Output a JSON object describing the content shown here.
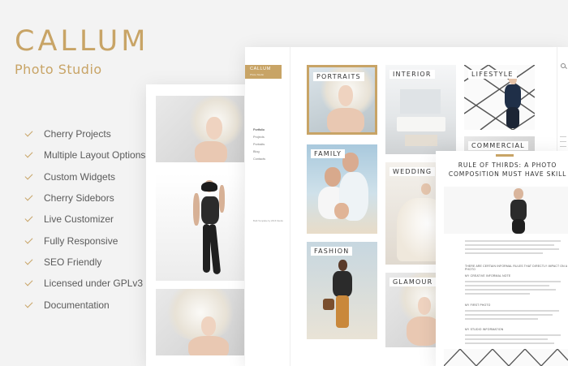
{
  "brand": {
    "title": "CALLUM",
    "subtitle": "Photo Studio"
  },
  "features": [
    "Cherry Projects",
    "Multiple Layout Options",
    "Custom Widgets",
    "Cherry Sidebors",
    "Live Customizer",
    "Fully Responsive",
    "SEO Friendly",
    "Licensed under GPLv3",
    "Documentation"
  ],
  "preview": {
    "logo": {
      "name": "CALLUM",
      "tagline": "Photo Studio"
    },
    "nav": [
      "Portfolio",
      "Projects",
      "Portraits",
      "Blog",
      "Contacts"
    ],
    "footer_text": "Built Template by 2016 Studio",
    "tiles": [
      "PORTRAITS",
      "INTERIOR",
      "LIFESTYLE",
      "FAMILY",
      "WEDDING",
      "COMMERCIAL",
      "FASHION",
      "GLAMOUR"
    ]
  },
  "article": {
    "title": "RULE OF THIRDS: A PHOTO COMPOSITION MUST HAVE SKILL",
    "subheads": [
      "THERE ARE CERTAIN INFORMAL RULES THAT DIRECTLY IMPACT ON A PHOTO",
      "MY CREATIVE INFORMAL NOTE",
      "MY FIRST PHOTO",
      "MY STUDIO INFORMATION"
    ]
  },
  "colors": {
    "accent": "#c8a466",
    "text": "#5b5b5b",
    "background": "#f3f3f3"
  }
}
